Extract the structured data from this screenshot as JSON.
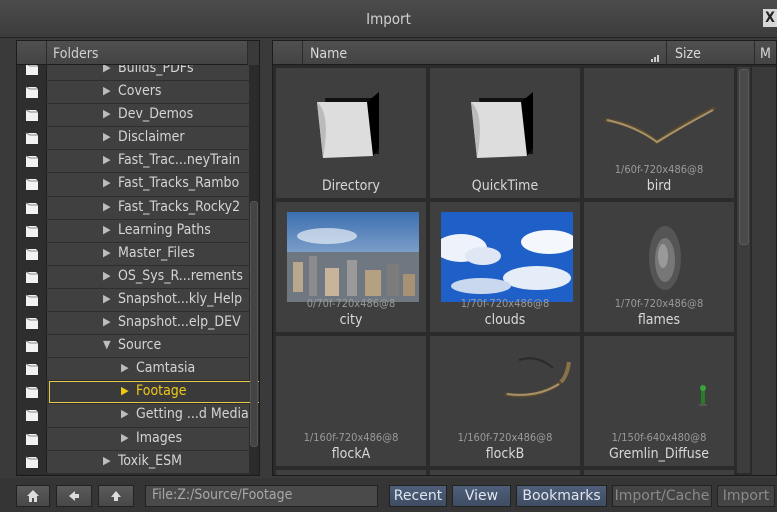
{
  "window": {
    "title": "Import",
    "close_label": "X"
  },
  "folders": {
    "header": "Folders",
    "items": [
      {
        "label": "Builds_PDFs",
        "indent": 0
      },
      {
        "label": "Covers",
        "indent": 0
      },
      {
        "label": "Dev_Demos",
        "indent": 0
      },
      {
        "label": "Disclaimer",
        "indent": 0
      },
      {
        "label": "Fast_Trac...neyTrain",
        "indent": 0
      },
      {
        "label": "Fast_Tracks_Rambo",
        "indent": 0
      },
      {
        "label": "Fast_Tracks_Rocky2",
        "indent": 0
      },
      {
        "label": "Learning Paths",
        "indent": 0
      },
      {
        "label": "Master_Files",
        "indent": 0
      },
      {
        "label": "OS_Sys_R...rements",
        "indent": 0
      },
      {
        "label": "Snapshot...kly_Help",
        "indent": 0
      },
      {
        "label": "Snapshot...elp_DEV",
        "indent": 0
      },
      {
        "label": "Source",
        "indent": 0,
        "expanded": true
      },
      {
        "label": "Camtasia",
        "indent": 1
      },
      {
        "label": "Footage",
        "indent": 1,
        "selected": true
      },
      {
        "label": "Getting ...d Media",
        "indent": 1
      },
      {
        "label": "Images",
        "indent": 1
      },
      {
        "label": "Toxik_ESM",
        "indent": 0
      }
    ],
    "arrow_collapsed": "▶",
    "arrow_expanded": "▼"
  },
  "files": {
    "headers": {
      "name": "Name",
      "size": "Size",
      "more": "M"
    },
    "items": [
      {
        "caption": "Directory",
        "meta": "",
        "thumb": "folder-icon"
      },
      {
        "caption": "QuickTime",
        "meta": "",
        "thumb": "folder-icon"
      },
      {
        "caption": "bird",
        "meta": "1/60f-720x486@8",
        "thumb": "bird-thumb"
      },
      {
        "caption": "city",
        "meta": "0/70f-720x486@8",
        "thumb": "city-thumb"
      },
      {
        "caption": "clouds",
        "meta": "1/70f-720x486@8",
        "thumb": "clouds-thumb"
      },
      {
        "caption": "flames",
        "meta": "1/70f-720x486@8",
        "thumb": "flames-thumb"
      },
      {
        "caption": "flockA",
        "meta": "1/160f-720x486@8",
        "thumb": "blank"
      },
      {
        "caption": "flockB",
        "meta": "1/160f-720x486@8",
        "thumb": "flock-thumb"
      },
      {
        "caption": "Gremlin_Diffuse",
        "meta": "1/150f-640x480@8",
        "thumb": "gremlin-thumb"
      }
    ]
  },
  "bottom": {
    "path": "File:Z:/Source/Footage",
    "buttons": {
      "recent": "Recent",
      "view": "View",
      "bookmarks": "Bookmarks",
      "import_cache": "Import/Cache",
      "import": "Import"
    }
  }
}
